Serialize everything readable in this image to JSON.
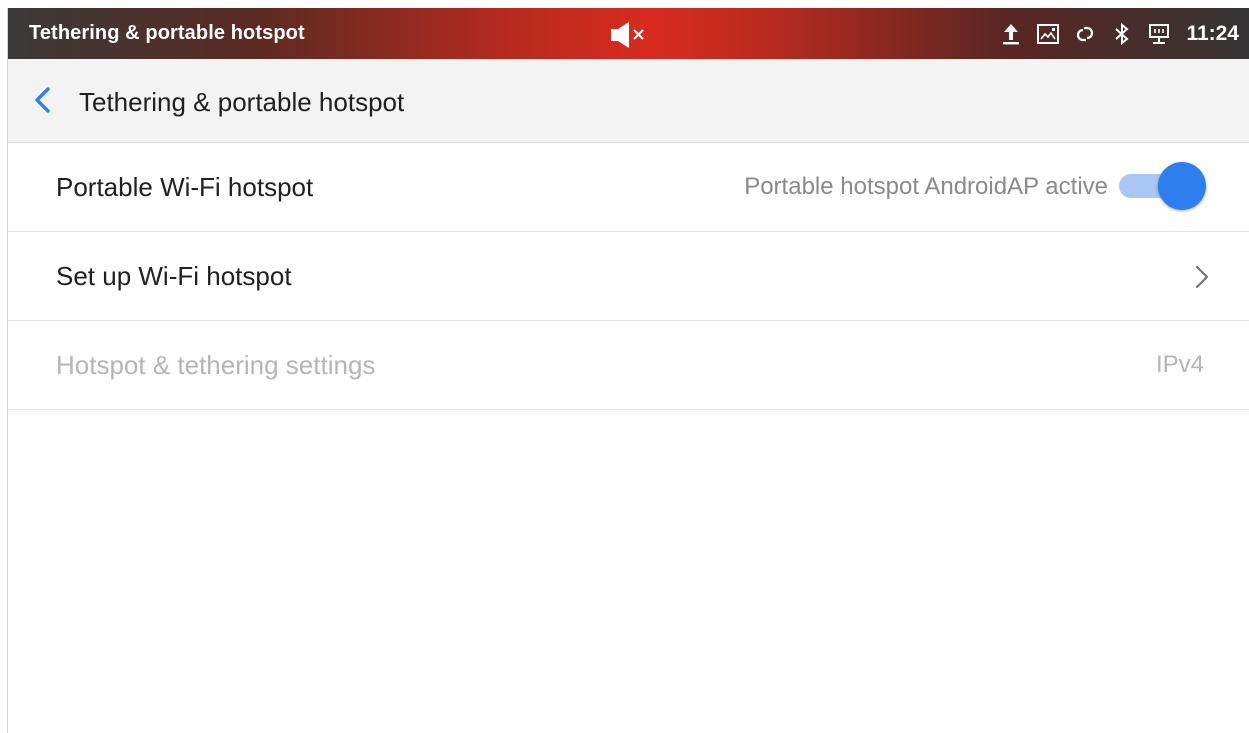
{
  "status_bar": {
    "title": "Tethering & portable hotspot",
    "time": "11:24",
    "icons": [
      "volume-muted-icon",
      "upload-icon",
      "screenshot-icon",
      "link-icon",
      "bluetooth-icon",
      "ethernet-icon"
    ]
  },
  "toolbar": {
    "title": "Tethering & portable hotspot",
    "back_icon": "chevron-left-icon",
    "accent_color": "#2f7ef0"
  },
  "list": {
    "items": [
      {
        "label": "Portable Wi-Fi hotspot",
        "summary": "Portable hotspot AndroidAP active",
        "control": "toggle",
        "checked": true,
        "enabled": true
      },
      {
        "label": "Set up Wi-Fi hotspot",
        "control": "chevron-right-icon",
        "enabled": true
      },
      {
        "label": "Hotspot & tethering settings",
        "value": "IPv4",
        "enabled": false
      }
    ]
  },
  "colors": {
    "status_bar_accent": "#d92b1f",
    "toggle_thumb": "#2f7ef0",
    "toggle_track": "#a9c7f2",
    "disabled_text": "#b5b5b5"
  }
}
